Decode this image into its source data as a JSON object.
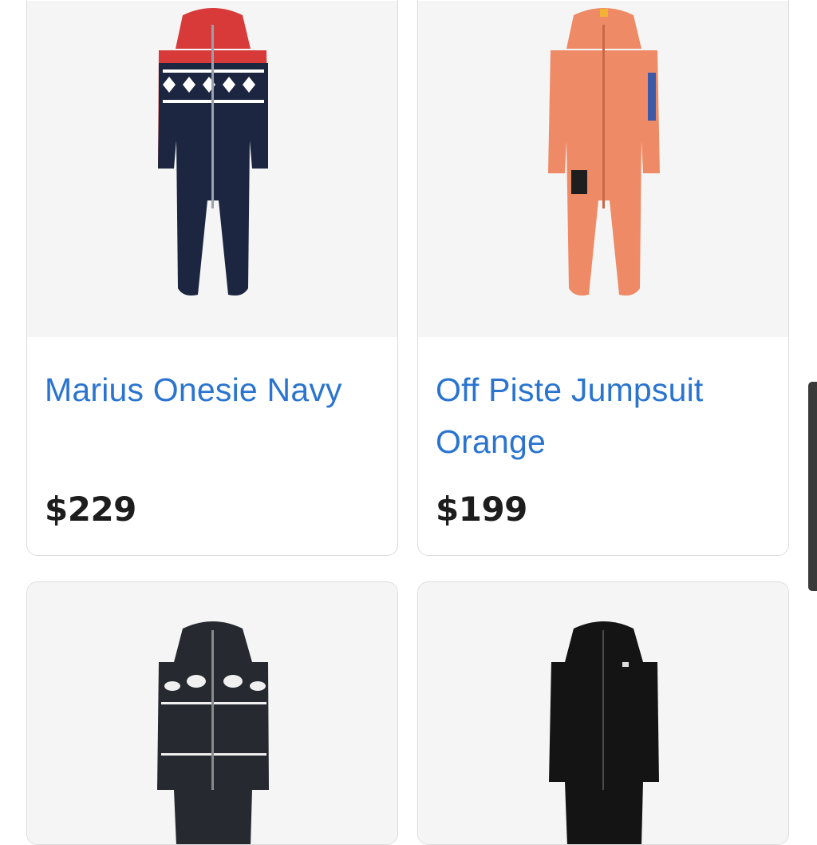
{
  "products": [
    {
      "name": "Marius Onesie Navy",
      "price": "$229",
      "image_icon": "navy-red-nordic-onesie-icon"
    },
    {
      "name": "Off Piste Jumpsuit Orange",
      "price": "$199",
      "image_icon": "orange-jumpsuit-icon"
    },
    {
      "name": "",
      "price": "",
      "image_icon": "polar-bear-pattern-onesie-icon"
    },
    {
      "name": "",
      "price": "",
      "image_icon": "black-velour-onesie-icon"
    }
  ],
  "colors": {
    "link": "#2a74d0",
    "price": "#1d1d1d",
    "card_border": "#dcdcdc",
    "image_bg": "#f5f5f5"
  }
}
